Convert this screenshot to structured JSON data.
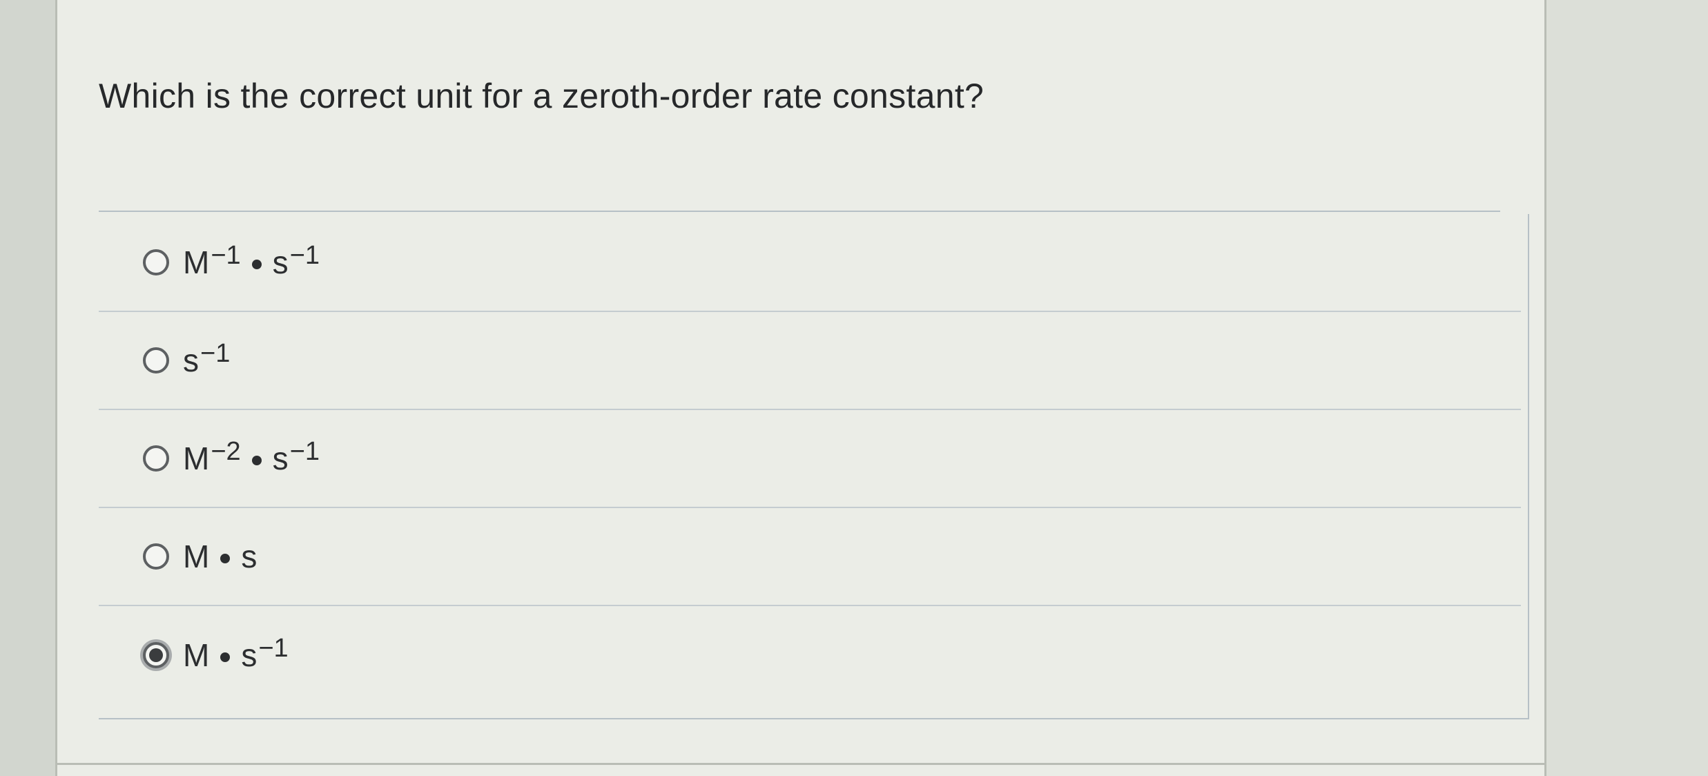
{
  "question": {
    "text": "Which is the correct unit for a zeroth-order rate constant?"
  },
  "options": [
    {
      "base1": "M",
      "exp1": "−1",
      "base2": "s",
      "exp2": "−1",
      "selected": false
    },
    {
      "base1": "s",
      "exp1": "−1",
      "selected": false
    },
    {
      "base1": "M",
      "exp1": "−2",
      "base2": "s",
      "exp2": "−1",
      "selected": false
    },
    {
      "base1": "M",
      "base2": "s",
      "selected": false
    },
    {
      "base1": "M",
      "base2": "s",
      "exp2": "−1",
      "selected": true
    }
  ],
  "icons": {
    "radio_unselected": "radio-button-empty-icon",
    "radio_selected": "radio-button-filled-icon",
    "separator": "bullet-dot-icon"
  },
  "colors": {
    "page_background": "#ebede7",
    "text": "#2b2d2e",
    "divider": "#b6c0c6"
  }
}
